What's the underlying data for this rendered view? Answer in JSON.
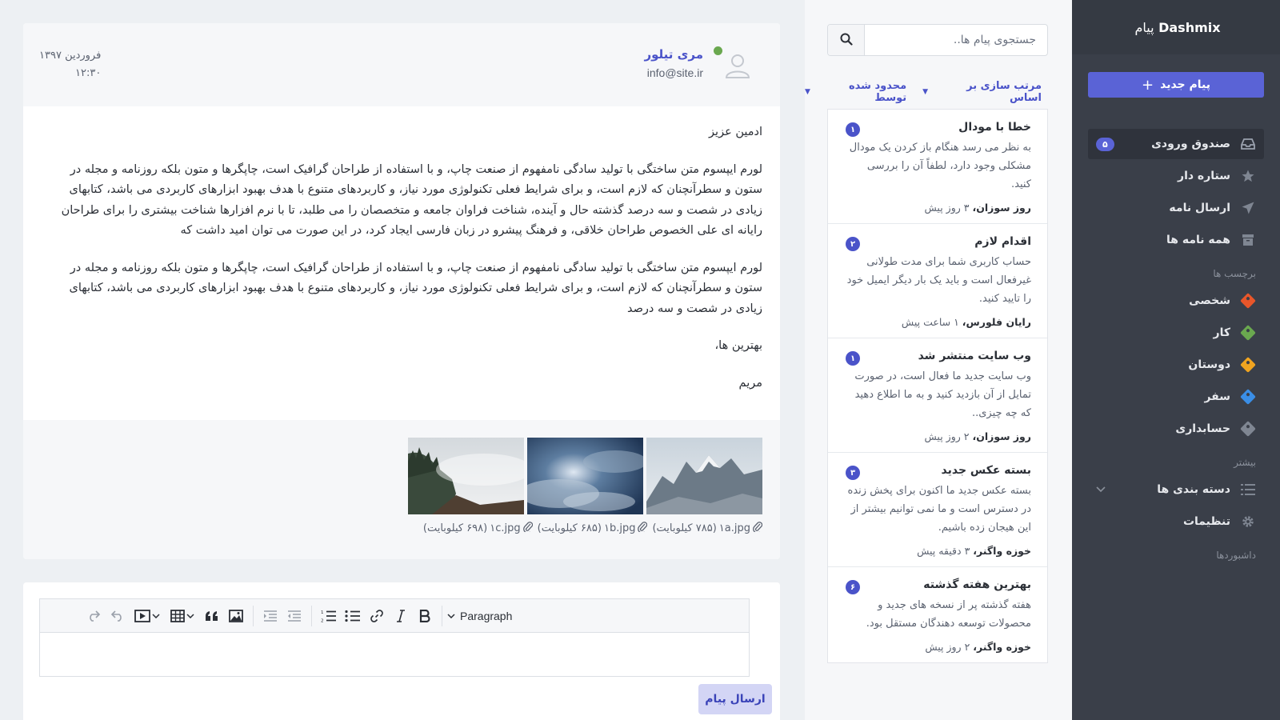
{
  "sidebar": {
    "brand_en": "Dashmix",
    "brand_fa": "پیام",
    "compose_label": "پیام جدید",
    "items": [
      {
        "label": "صندوق ورودی",
        "badge": "۵",
        "icon": "inbox-icon"
      },
      {
        "label": "ستاره دار",
        "icon": "star-icon"
      },
      {
        "label": "ارسال نامه",
        "icon": "send-icon"
      },
      {
        "label": "همه نامه ها",
        "icon": "archive-icon"
      }
    ],
    "labels_title": "برچسب ها",
    "labels": [
      {
        "label": "شخصی",
        "color": "#e8562a"
      },
      {
        "label": "کار",
        "color": "#6aa84f"
      },
      {
        "label": "دوستان",
        "color": "#f0a420"
      },
      {
        "label": "سفر",
        "color": "#3a8ee6"
      },
      {
        "label": "حسابداری",
        "color": "#7f8692"
      }
    ],
    "more_title": "بیشتر",
    "more": [
      {
        "label": "دسته بندی ها",
        "icon": "list-icon"
      },
      {
        "label": "تنظیمات",
        "icon": "gear-icon"
      }
    ],
    "dashboards_title": "داشبوردها"
  },
  "list": {
    "search_placeholder": "جستجوی پیام ها..",
    "sort_label": "مرتب سازی بر اساس",
    "filter_label": "محدود شده توسط",
    "messages": [
      {
        "title": "خطا با مودال",
        "badge": "۱",
        "text": "به نظر می رسد هنگام باز کردن یک مودال مشکلی وجود دارد، لطفاً آن را بررسی کنید.",
        "sender": "روز سوزان،",
        "time": "۳ روز پیش"
      },
      {
        "title": "اقدام لازم",
        "badge": "۲",
        "text": "حساب کاربری شما برای مدت طولانی غیرفعال است و باید یک بار دیگر ایمیل خود را تایید کنید.",
        "sender": "رایان فلورس،",
        "time": "۱ ساعت پیش"
      },
      {
        "title": "وب سایت منتشر شد",
        "badge": "۱",
        "text": "وب سایت جدید ما فعال است، در صورت تمایل از آن بازدید کنید و به ما اطلاع دهید که چه چیزی..",
        "sender": "روز سوزان،",
        "time": "۲ روز پیش"
      },
      {
        "title": "بسته عکس جدید",
        "badge": "۳",
        "text": "بسته عکس جدید ما اکنون برای پخش زنده در دسترس است و ما نمی توانیم بیشتر از این هیجان زده باشیم.",
        "sender": "خوزه واگنر،",
        "time": "۳ دقیقه پیش"
      },
      {
        "title": "بهترین هفته گذشته",
        "badge": "۶",
        "text": "هفته گذشته پر از نسخه های جدید و محصولات توسعه دهندگان مستقل بود.",
        "sender": "خوزه واگنر،",
        "time": "۲ روز پیش"
      }
    ]
  },
  "reading": {
    "sender_name": "مری تیلور",
    "sender_email": "info@site.ir",
    "date": "فروردین ۱۳۹۷",
    "time": "۱۲:۳۰",
    "greeting": "ادمین عزیز",
    "para1": "لورم ایپسوم متن ساختگی با تولید سادگی نامفهوم از صنعت چاپ، و با استفاده از طراحان گرافیک است، چاپگرها و متون بلکه روزنامه و مجله در ستون و سطرآنچنان که لازم است، و برای شرایط فعلی تکنولوژی مورد نیاز، و کاربردهای متنوع با هدف بهبود ابزارهای کاربردی می باشد، کتابهای زیادی در شصت و سه درصد گذشته حال و آینده، شناخت فراوان جامعه و متخصصان را می طلبد، تا با نرم افزارها شناخت بیشتری را برای طراحان رایانه ای علی الخصوص طراحان خلاقی، و فرهنگ پیشرو در زبان فارسی ایجاد کرد، در این صورت می توان امید داشت که",
    "para2": "لورم ایپسوم متن ساختگی با تولید سادگی نامفهوم از صنعت چاپ، و با استفاده از طراحان گرافیک است، چاپگرها و متون بلکه روزنامه و مجله در ستون و سطرآنچنان که لازم است، و برای شرایط فعلی تکنولوژی مورد نیاز، و کاربردهای متنوع با هدف بهبود ابزارهای کاربردی می باشد، کتابهای زیادی در شصت و سه درصد",
    "closing": "بهترین ها،",
    "signature": "مریم",
    "attachments": [
      {
        "name": "۱a.jpg",
        "size": "(۷۸۵ کیلوبایت)"
      },
      {
        "name": "۱b.jpg",
        "size": "(۶۸۵ کیلوبایت)"
      },
      {
        "name": "۱c.jpg",
        "size": "(۶۹۸ کیلوبایت)"
      }
    ]
  },
  "editor": {
    "format_label": "Paragraph",
    "send_label": "ارسال پیام"
  }
}
